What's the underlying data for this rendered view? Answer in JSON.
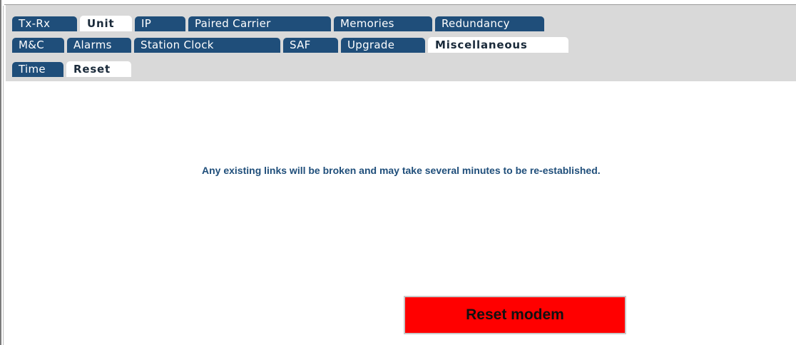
{
  "tabs": {
    "row1": [
      {
        "label": "Tx-Rx",
        "active": false
      },
      {
        "label": "Unit",
        "active": true
      },
      {
        "label": "IP",
        "active": false
      },
      {
        "label": "Paired Carrier",
        "active": false
      },
      {
        "label": "Memories",
        "active": false
      },
      {
        "label": "Redundancy",
        "active": false
      }
    ],
    "row2": [
      {
        "label": "M&C",
        "active": false
      },
      {
        "label": "Alarms",
        "active": false
      },
      {
        "label": "Station Clock",
        "active": false
      },
      {
        "label": "SAF",
        "active": false
      },
      {
        "label": "Upgrade",
        "active": false
      },
      {
        "label": "Miscellaneous",
        "active": true
      }
    ],
    "row3": [
      {
        "label": "Time",
        "active": false
      },
      {
        "label": "Reset",
        "active": true
      }
    ]
  },
  "content": {
    "message": "Any existing links will be broken and may take several minutes to be re-established.",
    "reset_button_label": "Reset modem"
  },
  "colors": {
    "tab_bg": "#1f4e7a",
    "tab_active_bg": "#ffffff",
    "tab_strip_bg": "#d9d9d9",
    "message_text": "#1f4e7a",
    "reset_button_bg": "#ff0000"
  }
}
